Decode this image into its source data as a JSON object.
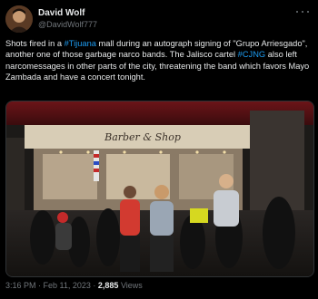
{
  "author": {
    "display_name": "David Wolf",
    "handle": "@DavidWolf777"
  },
  "tweet": {
    "text_1": "Shots fired in a ",
    "hashtag_1": "#Tijuana",
    "text_2": " mall during an autograph signing of \"Grupo Arriesgado\", another one of those garbage narco bands. The Jalisco cartel ",
    "hashtag_2": "#CJNG",
    "text_3": " also left narcomessages in other parts of the city, threatening the band which favors Mayo Zambada and have a concert tonight."
  },
  "media": {
    "store_sign_text": "Barber & Shop"
  },
  "meta": {
    "time": "3:16 PM",
    "separator_1": " · ",
    "date": "Feb 11, 2023",
    "separator_2": " · ",
    "views_count": "2,885",
    "views_label": " Views"
  },
  "colors": {
    "background": "#000000",
    "text": "#e7e9ea",
    "secondary": "#71767b",
    "link": "#1d9bf0"
  },
  "icons": [
    "more-icon",
    "avatar"
  ]
}
